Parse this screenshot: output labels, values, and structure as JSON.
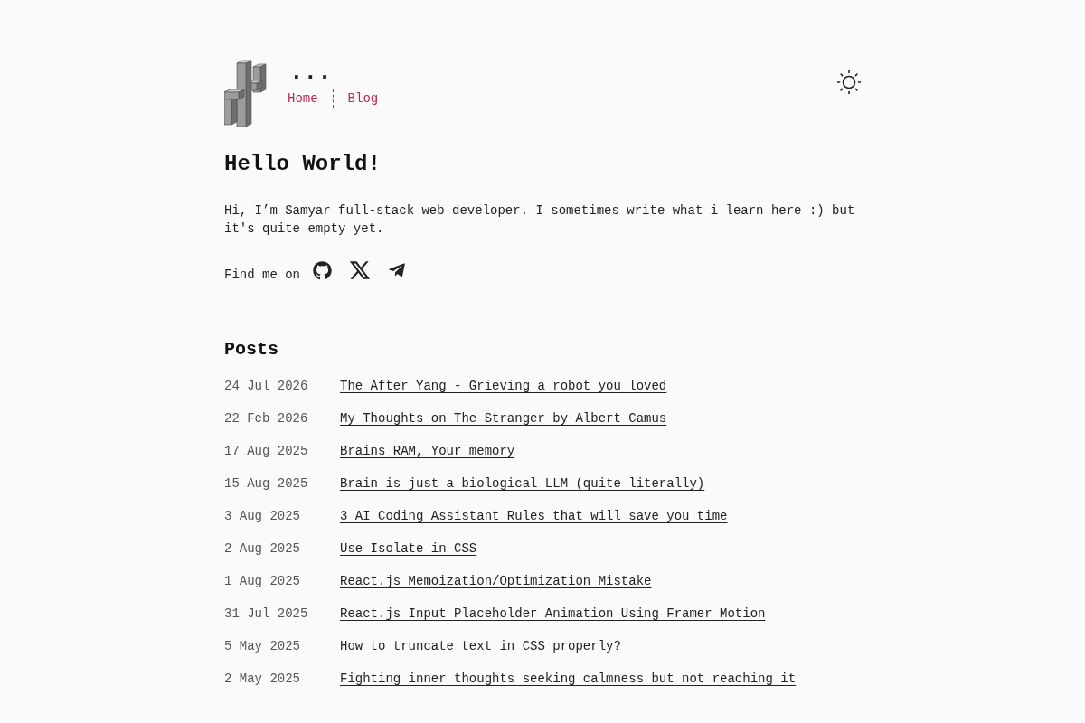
{
  "site": {
    "title": "..."
  },
  "nav": [
    {
      "label": "Home"
    },
    {
      "label": "Blog"
    }
  ],
  "intro": {
    "heading": "Hello World!",
    "text": "Hi, I’m Samyar full-stack web developer. I sometimes write what i learn here :) but it's quite empty yet.",
    "find_me_label": "Find me on"
  },
  "socials": [
    {
      "kind": "github"
    },
    {
      "kind": "x"
    },
    {
      "kind": "telegram"
    }
  ],
  "posts": {
    "heading": "Posts",
    "items": [
      {
        "date": "24 Jul 2026",
        "title": "The After Yang - Grieving a robot you loved"
      },
      {
        "date": "22 Feb 2026",
        "title": "My Thoughts on The Stranger by Albert Camus"
      },
      {
        "date": "17 Aug 2025",
        "title": "Brains RAM, Your memory"
      },
      {
        "date": "15 Aug 2025",
        "title": "Brain is just a biological LLM (quite literally)"
      },
      {
        "date": "3 Aug 2025",
        "title": "3 AI Coding Assistant Rules that will save you time"
      },
      {
        "date": "2 Aug 2025",
        "title": "Use Isolate in CSS"
      },
      {
        "date": "1 Aug 2025",
        "title": "React.js Memoization/Optimization Mistake"
      },
      {
        "date": "31 Jul 2025",
        "title": "React.js Input Placeholder Animation Using Framer Motion"
      },
      {
        "date": "5 May 2025",
        "title": "How to truncate text in CSS properly?"
      },
      {
        "date": "2 May 2025",
        "title": "Fighting inner thoughts seeking calmness but not reaching it"
      }
    ]
  }
}
